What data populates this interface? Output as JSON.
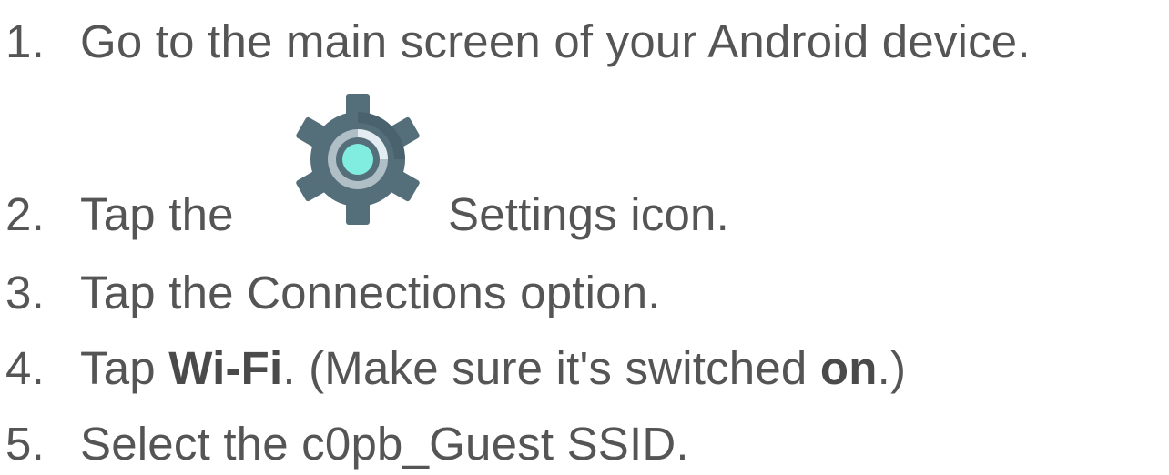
{
  "steps": [
    {
      "number": "1.",
      "text": "Go to the main screen of your Android device."
    },
    {
      "number": "2.",
      "before_icon": "Tap the",
      "after_icon": "Settings icon.",
      "icon": "settings-gear-icon"
    },
    {
      "number": "3.",
      "text": "Tap the Connections option."
    },
    {
      "number": "4.",
      "pre": "Tap ",
      "bold1": "Wi-Fi",
      "mid": ". (Make sure it's switched ",
      "bold2": "on",
      "post": ".)"
    },
    {
      "number": "5.",
      "text": "Select the c0pb_Guest SSID."
    }
  ],
  "colors": {
    "text": "#555555",
    "gear": "#546e7a",
    "ring": "#b0bec5",
    "center": "#80ede0"
  }
}
